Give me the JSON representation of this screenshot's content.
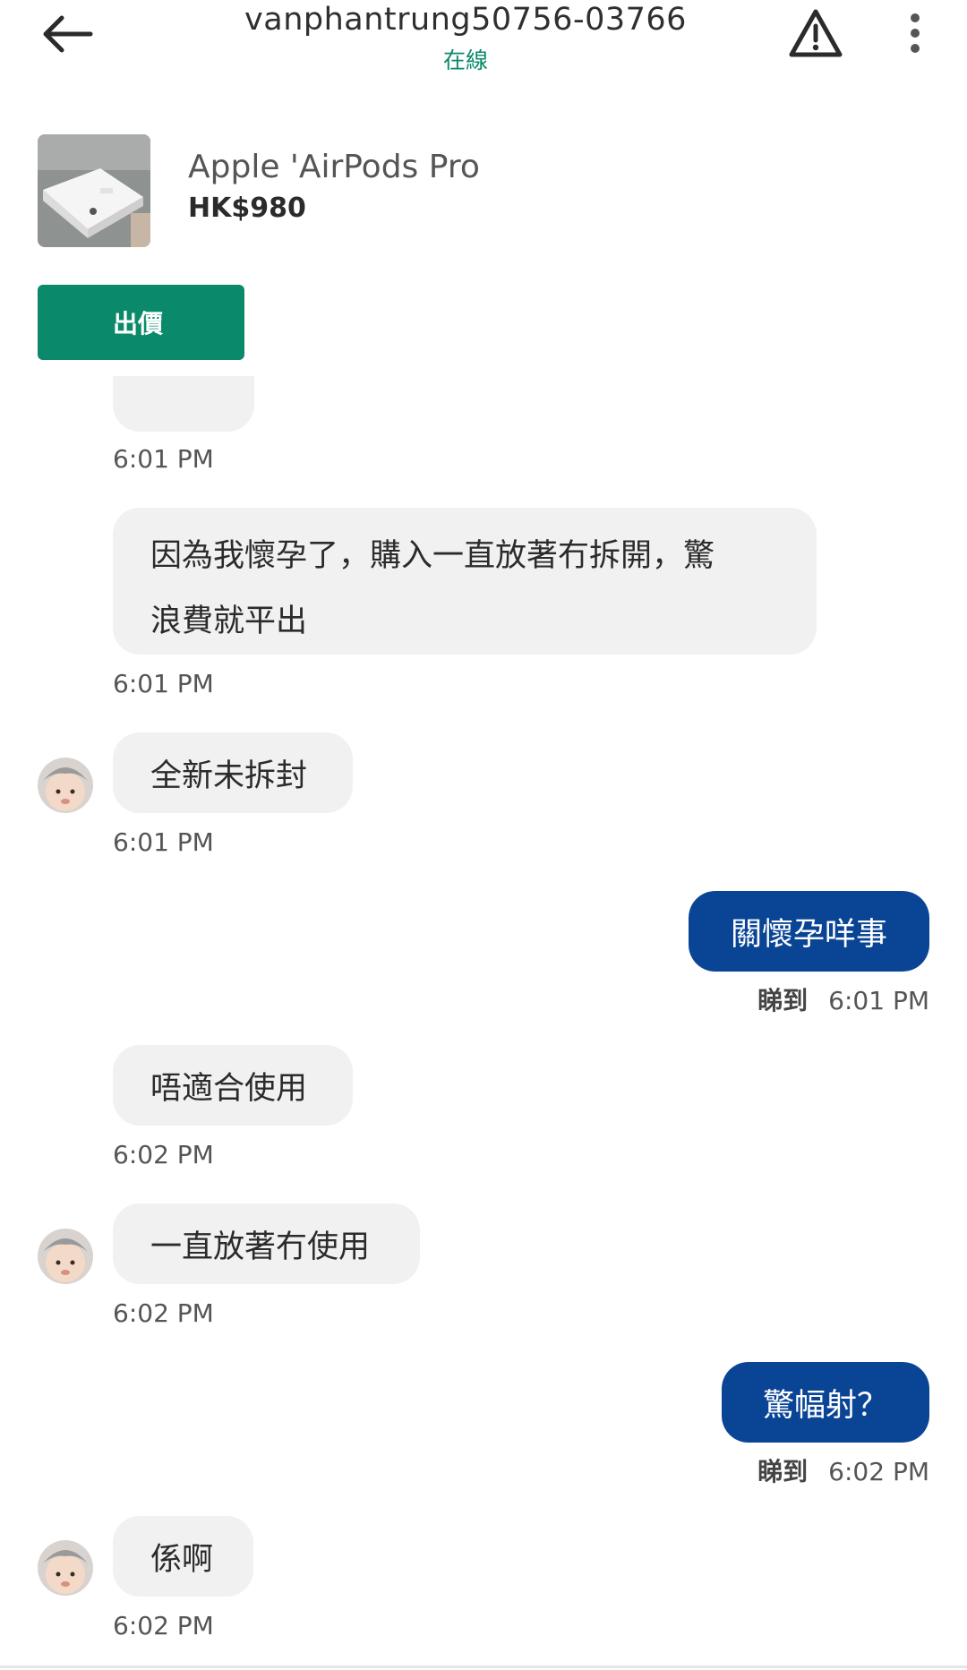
{
  "header": {
    "username": "vanphantrung50756-03766",
    "status": "在線",
    "status_color": "#0b8a6b",
    "back_icon": "arrow-left-icon",
    "report_icon": "warning-triangle-icon",
    "more_icon": "more-vertical-icon"
  },
  "product": {
    "name": "Apple 'AirPods Pro",
    "price": "HK$980",
    "offer_label": "出價",
    "offer_color": "#0b8a6b"
  },
  "messages": {
    "m0_time": "6:01 PM",
    "m1_line1": "因為我懷孕了，購入一直放著冇拆開，驚",
    "m1_line2": "浪費就平出",
    "m1_time": "6:01 PM",
    "m2_text": "全新未拆封",
    "m2_time": "6:01 PM",
    "m3_text": "關懷孕咩事",
    "m3_seen": "睇到",
    "m3_time": "6:01 PM",
    "m4_text": "唔適合使用",
    "m4_time": "6:02 PM",
    "m5_text": "一直放著冇使用",
    "m5_time": "6:02 PM",
    "m6_text": "驚幅射？",
    "m6_seen": "睇到",
    "m6_time": "6:02 PM",
    "m7_text": "係啊",
    "m7_time": "6:02 PM"
  },
  "colors": {
    "incoming_bubble": "#f0f1f0",
    "outgoing_bubble": "#0a4595"
  }
}
